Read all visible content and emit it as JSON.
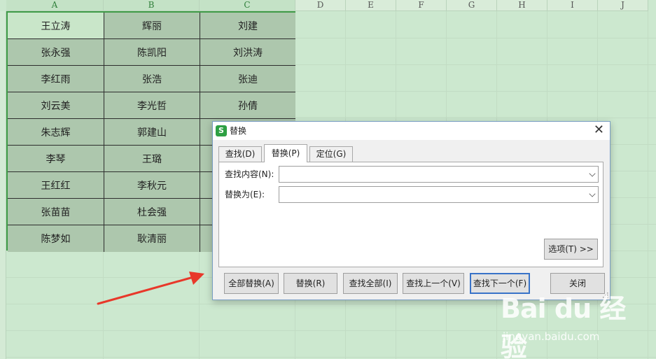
{
  "sheet": {
    "columns": [
      "A",
      "B",
      "C",
      "D",
      "E",
      "F",
      "G",
      "H",
      "I",
      "J"
    ],
    "rows": [
      [
        "王立涛",
        "辉丽",
        "刘建"
      ],
      [
        "张永强",
        "陈凯阳",
        "刘洪涛"
      ],
      [
        "李红雨",
        "张浩",
        "张迪"
      ],
      [
        "刘云美",
        "李光哲",
        "孙倩"
      ],
      [
        "朱志辉",
        "郭建山",
        ""
      ],
      [
        "李琴",
        "王璐",
        ""
      ],
      [
        "王红红",
        "李秋元",
        ""
      ],
      [
        "张苗苗",
        "杜会强",
        ""
      ],
      [
        "陈梦如",
        "耿清丽",
        ""
      ]
    ]
  },
  "dialog": {
    "icon_letter": "S",
    "title": "替换",
    "close_glyph": "✕",
    "tabs": [
      {
        "label": "查找(D)",
        "active": false
      },
      {
        "label": "替换(P)",
        "active": true
      },
      {
        "label": "定位(G)",
        "active": false
      }
    ],
    "find_label": "查找内容(N):",
    "find_value": "",
    "replace_label": "替换为(E):",
    "replace_value": "",
    "options_label": "选项(T) >>",
    "buttons": {
      "replace_all": "全部替换(A)",
      "replace": "替换(R)",
      "find_all": "查找全部(I)",
      "find_prev": "查找上一个(V)",
      "find_next": "查找下一个(F)",
      "close": "关闭"
    }
  },
  "watermark": {
    "logo": "Bai du 经验",
    "url": "jingyan.baidu.com"
  },
  "colors": {
    "sheet_bg": "#cce8cf",
    "selection_border": "#3f9b47",
    "cell_fill": "#adc7ad",
    "arrow": "#e8382a",
    "default_button_border": "#3873c8",
    "app_icon": "#2ea043"
  },
  "icons": {
    "app": "wps-spreadsheet-icon",
    "close": "close-icon",
    "dropdown": "chevron-down-icon",
    "arrow": "red-arrow-annotation"
  }
}
